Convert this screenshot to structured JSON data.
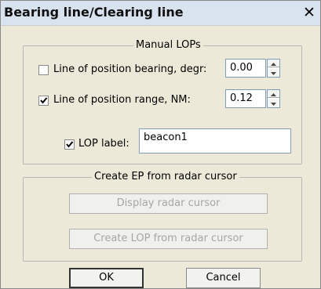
{
  "window": {
    "title": "Bearing line/Clearing line",
    "close_glyph": "✕"
  },
  "manual_lops": {
    "legend": "Manual LOPs",
    "bearing": {
      "label": "Line of position bearing, degr:",
      "checked": false,
      "value": "0.00"
    },
    "range": {
      "label": "Line of position range,  NM:",
      "checked": true,
      "value": "0.12"
    },
    "lop_label": {
      "label": "LOP label:",
      "checked": true,
      "value": "beacon1"
    }
  },
  "radar": {
    "legend": "Create EP from radar cursor",
    "display_button": "Display radar cursor",
    "create_button": "Create LOP from radar cursor"
  },
  "footer": {
    "ok_label": "OK",
    "cancel_label": "Cancel"
  },
  "icons": {
    "close": "close-icon",
    "check": "checkmark-icon",
    "spin_up": "arrow-up-icon",
    "spin_down": "arrow-down-icon"
  }
}
